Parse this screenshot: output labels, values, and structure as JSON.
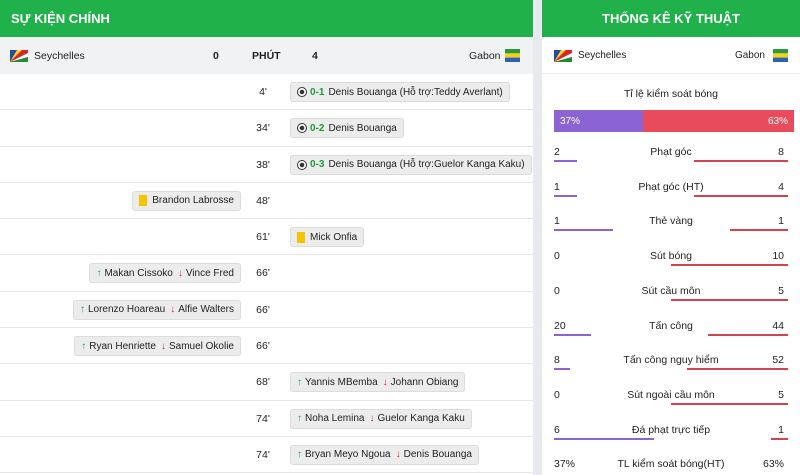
{
  "events_panel": {
    "title": "Sự kiện chính",
    "home_team": "Seychelles",
    "home_score": "0",
    "minute_header": "PHÚT",
    "away_score": "4",
    "away_team": "Gabon",
    "events": [
      {
        "side": "away",
        "minute": "4'",
        "type": "goal",
        "score": "0-1",
        "text": "Denis Bouanga (Hỗ trợ:Teddy Averlant)"
      },
      {
        "side": "away",
        "minute": "34'",
        "type": "goal",
        "score": "0-2",
        "text": "Denis Bouanga"
      },
      {
        "side": "away",
        "minute": "38'",
        "type": "goal",
        "score": "0-3",
        "text": "Denis Bouanga (Hỗ trợ:Guelor Kanga Kaku)"
      },
      {
        "side": "home",
        "minute": "48'",
        "type": "yellow",
        "text": "Brandon Labrosse"
      },
      {
        "side": "away",
        "minute": "61'",
        "type": "yellow",
        "text": "Mick Onfia"
      },
      {
        "side": "home",
        "minute": "66'",
        "type": "sub",
        "in": "Makan Cissoko",
        "out": "Vince Fred"
      },
      {
        "side": "home",
        "minute": "66'",
        "type": "sub",
        "in": "Lorenzo Hoareau",
        "out": "Alfie Walters"
      },
      {
        "side": "home",
        "minute": "66'",
        "type": "sub",
        "in": "Ryan Henriette",
        "out": "Samuel Okolie"
      },
      {
        "side": "away",
        "minute": "68'",
        "type": "sub",
        "in": "Yannis MBemba",
        "out": "Johann Obiang"
      },
      {
        "side": "away",
        "minute": "74'",
        "type": "sub",
        "in": "Noha Lemina",
        "out": "Guelor Kanga Kaku"
      },
      {
        "side": "away",
        "minute": "74'",
        "type": "sub",
        "in": "Bryan Meyo Ngoua",
        "out": "Denis Bouanga"
      }
    ]
  },
  "stats_panel": {
    "title": "Thống kê kỹ thuật",
    "home_team": "Seychelles",
    "away_team": "Gabon",
    "possession_label": "Tỉ lệ kiểm soát bóng",
    "possession_home": "37%",
    "possession_away": "63%",
    "stats": [
      {
        "label": "Phạt góc",
        "home": "2",
        "away": "8"
      },
      {
        "label": "Phạt góc (HT)",
        "home": "1",
        "away": "4"
      },
      {
        "label": "Thẻ vàng",
        "home": "1",
        "away": "1"
      },
      {
        "label": "Sút bóng",
        "home": "0",
        "away": "10"
      },
      {
        "label": "Sút cầu môn",
        "home": "0",
        "away": "5"
      },
      {
        "label": "Tấn công",
        "home": "20",
        "away": "44"
      },
      {
        "label": "Tấn công nguy hiểm",
        "home": "8",
        "away": "52"
      },
      {
        "label": "Sút ngoài cầu môn",
        "home": "0",
        "away": "5"
      },
      {
        "label": "Đá phạt trực tiếp",
        "home": "6",
        "away": "1"
      },
      {
        "label": "TL kiểm soát bóng(HT)",
        "home": "37%",
        "away": "63%"
      }
    ]
  },
  "colors": {
    "header_green": "#20b14a",
    "home_bar": "#8b63d2",
    "away_bar": "#d2434f",
    "goal_green": "#1b9c3a",
    "yellow_card": "#f5c400"
  },
  "icons": {
    "goal": "soccer-ball-icon",
    "yellow": "yellow-card-icon",
    "sub_in": "arrow-up-icon",
    "sub_out": "arrow-down-icon"
  }
}
